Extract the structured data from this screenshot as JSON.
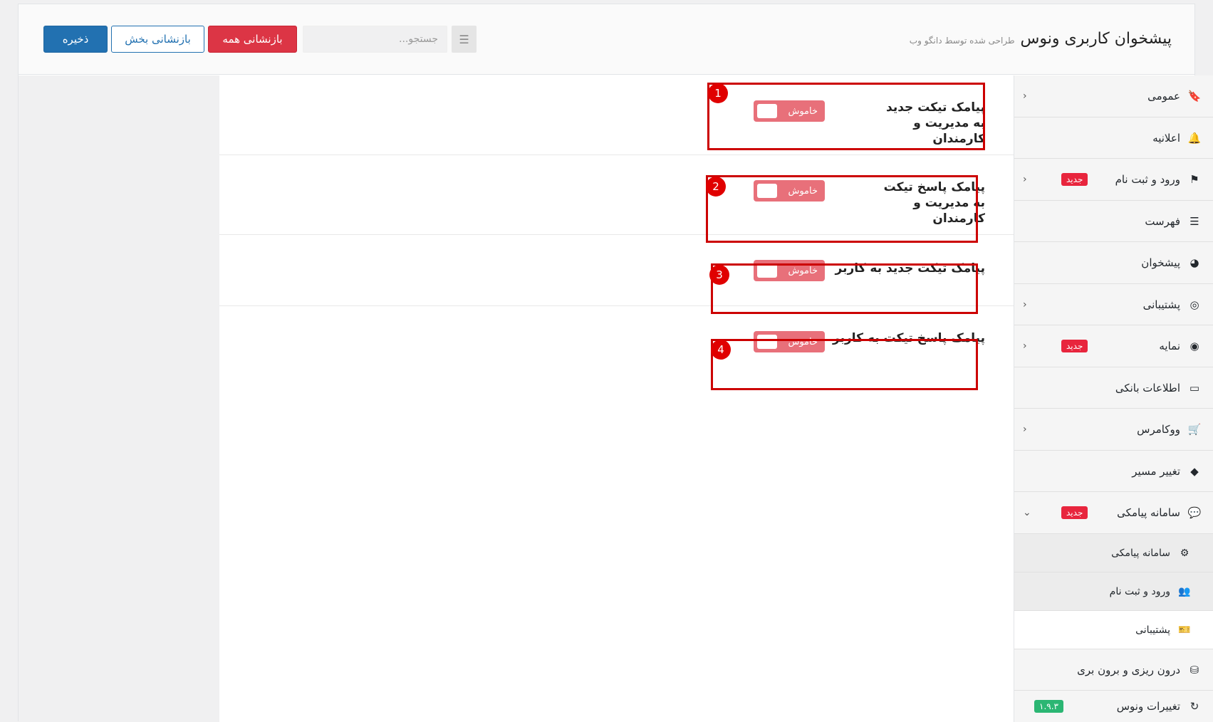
{
  "header": {
    "title": "پیشخوان کاربری ونوس",
    "subtitle": "طراحی شده توسط دانگو وب",
    "save_label": "ذخیره",
    "reset_section_label": "بازنشانی بخش",
    "reset_all_label": "بازنشانی همه",
    "search_placeholder": "جستجو..."
  },
  "fields": [
    {
      "label": "پیامک تیکت جدید به مدیریت و کارمندان",
      "toggle": "خاموش",
      "number": "1"
    },
    {
      "label": "پیامک پاسخ تیکت به مدیریت و کارمندان",
      "toggle": "خاموش",
      "number": "2"
    },
    {
      "label": "پیامک تیکت جدید به کاربر",
      "toggle": "خاموش",
      "number": "3"
    },
    {
      "label": "پیامک پاسخ تیکت به کاربر",
      "toggle": "خاموش",
      "number": "4"
    }
  ],
  "sidebar": {
    "items": [
      {
        "label": "عمومی",
        "icon": "bookmark-icon"
      },
      {
        "label": "اعلانیه",
        "icon": "bell-icon"
      },
      {
        "label": "ورود و ثبت نام",
        "icon": "signpost-icon",
        "badge": "جدید"
      },
      {
        "label": "فهرست",
        "icon": "list-icon"
      },
      {
        "label": "پیشخوان",
        "icon": "dashboard-icon"
      },
      {
        "label": "پشتیبانی",
        "icon": "lifering-icon"
      },
      {
        "label": "نمایه",
        "icon": "user-circle-icon",
        "badge": "جدید"
      },
      {
        "label": "اطلاعات بانکی",
        "icon": "credit-card-icon"
      },
      {
        "label": "ووکامرس",
        "icon": "cart-icon"
      },
      {
        "label": "تغییر مسیر",
        "icon": "route-icon"
      },
      {
        "label": "سامانه پیامکی",
        "icon": "comments-icon",
        "badge": "جدید"
      },
      {
        "label": "درون ریزی و برون بری",
        "icon": "database-icon"
      },
      {
        "label": "تغییرات ونوس",
        "icon": "refresh-icon",
        "badge": "۱.۹.۳"
      }
    ],
    "subitems": [
      {
        "label": "سامانه پیامکی",
        "icon": "cogs-icon"
      },
      {
        "label": "ورود و ثبت نام",
        "icon": "users-icon"
      },
      {
        "label": "پشتیبانی",
        "icon": "ticket-icon"
      }
    ]
  }
}
